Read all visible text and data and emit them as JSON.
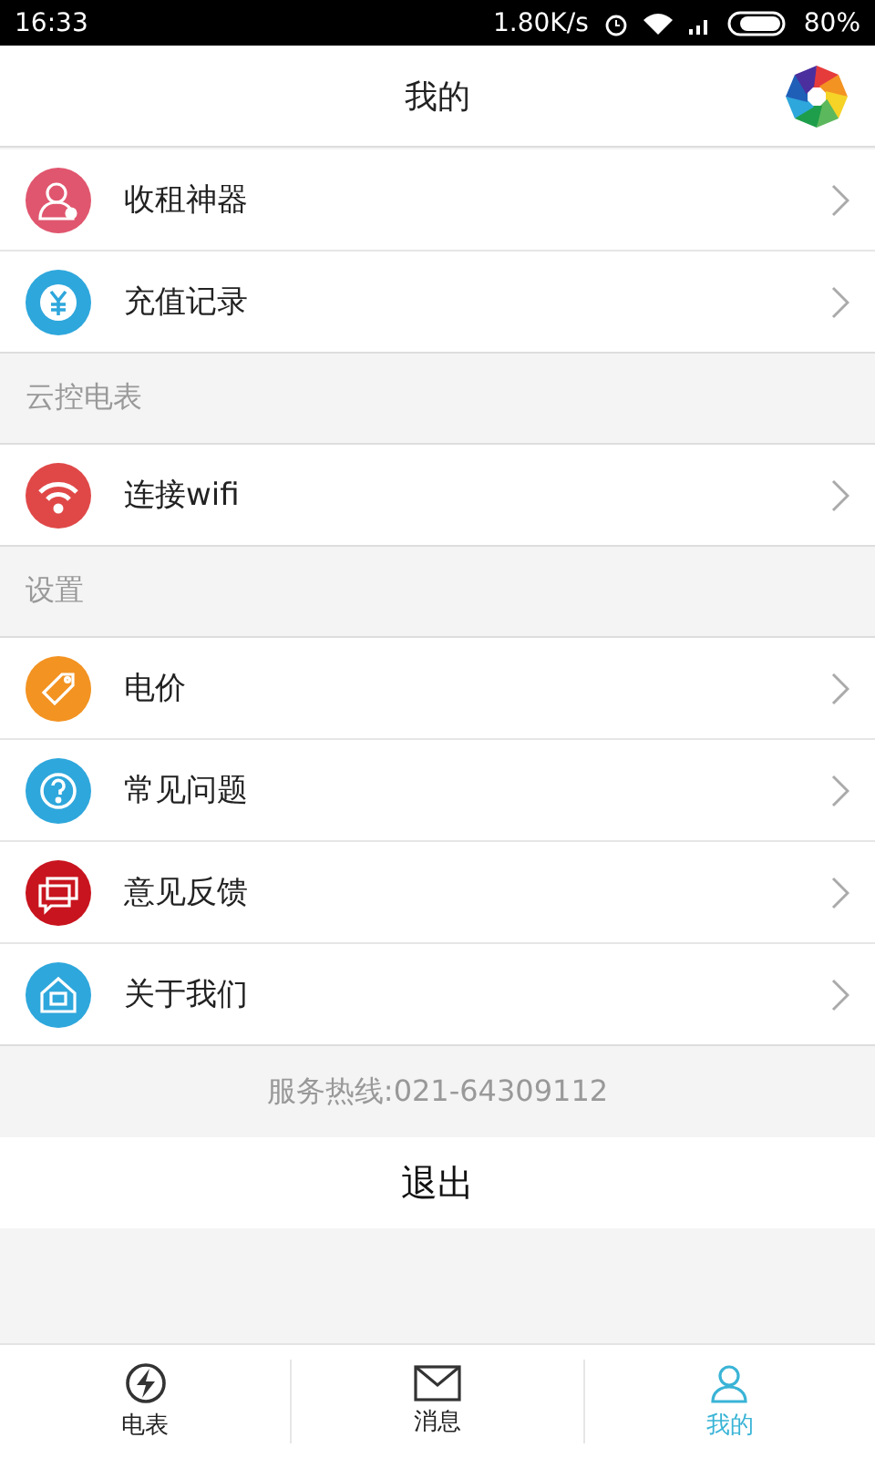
{
  "status_bar": {
    "time": "16:33",
    "speed": "1.80K/s",
    "battery": "80%"
  },
  "header": {
    "title": "我的"
  },
  "sections": [
    {
      "items": [
        {
          "label": "收租神器",
          "color": "#e0566e"
        },
        {
          "label": "充值记录",
          "color": "#2ea7dc"
        }
      ]
    },
    {
      "title": "云控电表",
      "items": [
        {
          "label": "连接wifi",
          "color": "#e04848"
        }
      ]
    },
    {
      "title": "设置",
      "items": [
        {
          "label": "电价",
          "color": "#f39322"
        },
        {
          "label": "常见问题",
          "color": "#2ea7dc"
        },
        {
          "label": "意见反馈",
          "color": "#c8141e"
        },
        {
          "label": "关于我们",
          "color": "#2ea7dc"
        }
      ]
    }
  ],
  "hotline": "服务热线:021-64309112",
  "logout": "退出",
  "tabs": [
    {
      "label": "电表",
      "selected": false
    },
    {
      "label": "消息",
      "selected": false
    },
    {
      "label": "我的",
      "selected": true
    }
  ]
}
